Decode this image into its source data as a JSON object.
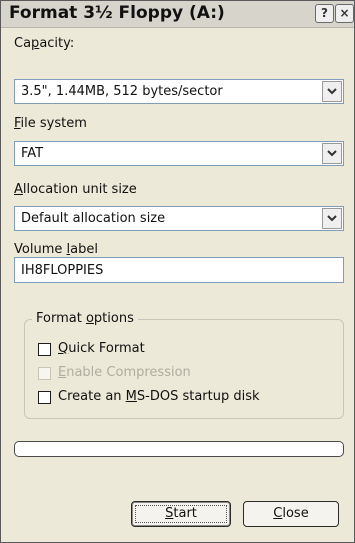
{
  "window": {
    "title": "Format 3½ Floppy (A:)",
    "help_button": "?",
    "close_button": "×"
  },
  "capacity": {
    "label": "Capacity:",
    "value": "3.5\",  1.44MB, 512 bytes/sector"
  },
  "file_system": {
    "label": "File system",
    "value": "FAT"
  },
  "allocation": {
    "label": "Allocation unit size",
    "value": "Default allocation size"
  },
  "volume": {
    "label": "Volume label",
    "value": "IH8FLOPPIES"
  },
  "format_options": {
    "title": "Format options",
    "quick_format": {
      "label": "Quick Format",
      "checked": false,
      "enabled": true
    },
    "enable_compression": {
      "label": "Enable Compression",
      "checked": false,
      "enabled": false
    },
    "msdos_startup": {
      "label": "Create an MS-DOS startup disk",
      "checked": false,
      "enabled": true
    }
  },
  "progress": {
    "value": 0
  },
  "buttons": {
    "start": "Start",
    "close": "Close"
  }
}
